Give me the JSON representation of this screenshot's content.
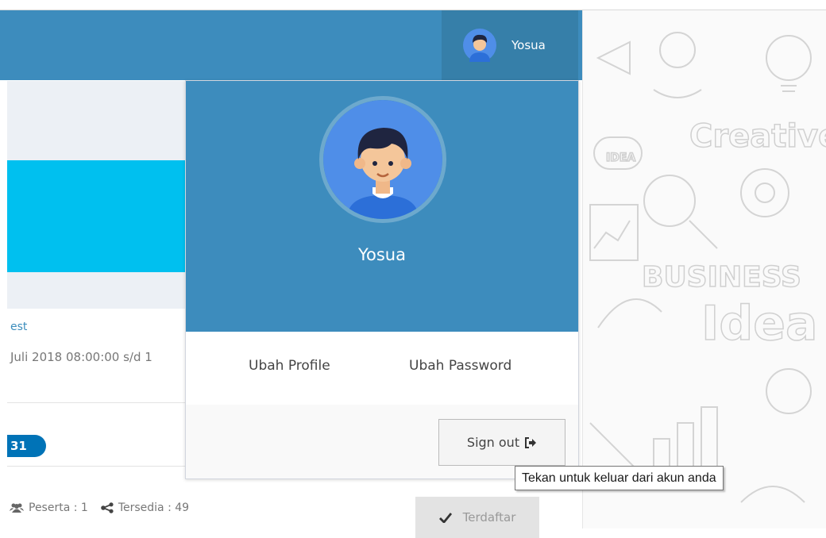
{
  "navbar": {
    "user_name": "Yosua"
  },
  "event_card": {
    "title_fragment": "est",
    "date_fragment": "Juli 2018 08:00:00 s/d 1",
    "badge_text": "31",
    "participants_label": "Peserta : 1",
    "available_label": "Tersedia : 49",
    "registered_label": "Terdaftar"
  },
  "user_dropdown": {
    "name": "Yosua",
    "edit_profile_label": "Ubah Profile",
    "change_password_label": "Ubah Password",
    "sign_out_label": "Sign out",
    "sign_out_tooltip": "Tekan untuk keluar dari akun anda"
  },
  "background_doodle_words": [
    "Creative",
    "IDEA",
    "BUSINESS",
    "Idea"
  ],
  "colors": {
    "header": "#3d8cbd",
    "user_menu": "#367fa9",
    "info_box": "#00c0ef",
    "badge": "#0073b7",
    "link": "#3c8dbc"
  },
  "icons": {
    "user_avatar": "user-avatar-icon",
    "sign_out": "sign-out-icon",
    "participants": "users-icon",
    "available": "share-icon",
    "registered": "check-icon"
  }
}
